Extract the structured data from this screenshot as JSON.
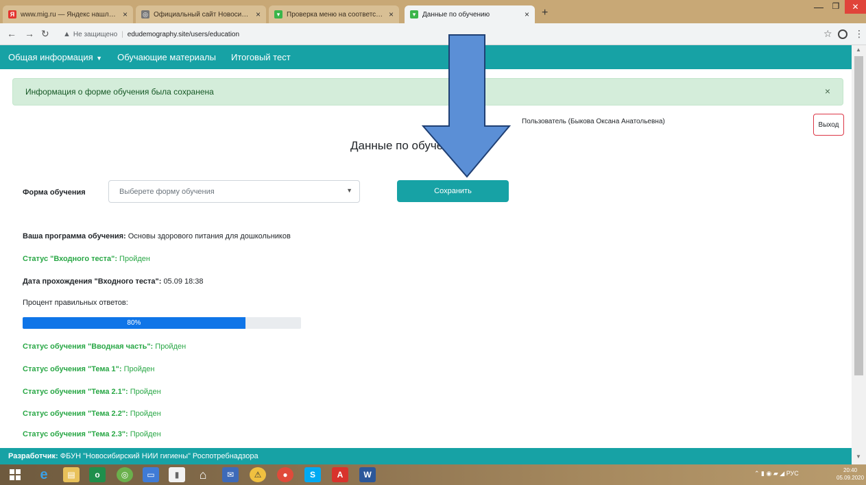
{
  "browser": {
    "tabs": [
      {
        "title": "www.mig.ru — Яндекс нашлось",
        "favicon": "yandex-icon",
        "color": "#e3342f",
        "active": false
      },
      {
        "title": "Официальный сайт Новосибирск",
        "favicon": "globe-icon",
        "color": "#555555",
        "active": false
      },
      {
        "title": "Проверка меню на соответствие",
        "favicon": "site-icon",
        "color": "#3bb54a",
        "active": false
      },
      {
        "title": "Данные по обучению",
        "favicon": "site-icon",
        "color": "#3bb54a",
        "active": true
      }
    ],
    "new_tab": "+",
    "not_secure": "Не защищено",
    "url": "edudemography.site/users/education"
  },
  "navbar": {
    "items": [
      "Общая информация",
      "Обучающие материалы",
      "Итоговый тест"
    ]
  },
  "alert": {
    "text": "Информация о форме обучения была сохранена",
    "close": "×"
  },
  "user": {
    "label": "Пользователь (Быкова Оксана Анатольевна)",
    "logout": "Выход"
  },
  "page_title": "Данные по обучению",
  "form": {
    "label": "Форма обучения",
    "select_value": "Выберете форму обучения",
    "save": "Сохранить"
  },
  "info": {
    "program_label": "Ваша программа обучения:",
    "program_value": "Основы здорового питания для дошкольников",
    "entry_test_label": "Статус \"Входного теста\":",
    "entry_test_value": "Пройден",
    "entry_date_label": "Дата прохождения \"Входного теста\":",
    "entry_date_value": "05.09 18:38",
    "percent_label": "Процент правильных ответов:",
    "percent_value": "80%",
    "percent": 80
  },
  "statuses": [
    {
      "label": "Статус обучения \"Вводная часть\":",
      "value": "Пройден"
    },
    {
      "label": "Статус обучения \"Тема 1\":",
      "value": "Пройден"
    },
    {
      "label": "Статус обучения \"Тема 2.1\":",
      "value": "Пройден"
    },
    {
      "label": "Статус обучения \"Тема 2.2\":",
      "value": "Пройден"
    },
    {
      "label": "Статус обучения \"Тема 2.3\":",
      "value": "Пройден"
    }
  ],
  "footer": {
    "label": "Разработчик:",
    "text": "ФБУН \"Новосибирский НИИ гигиены\" Роспотребнадзора"
  },
  "taskbar": {
    "tray_lang": "РУС",
    "time": "20:40",
    "date": "05.09.2020"
  },
  "overlay": {
    "arrow_color": "#5b8fd6"
  }
}
